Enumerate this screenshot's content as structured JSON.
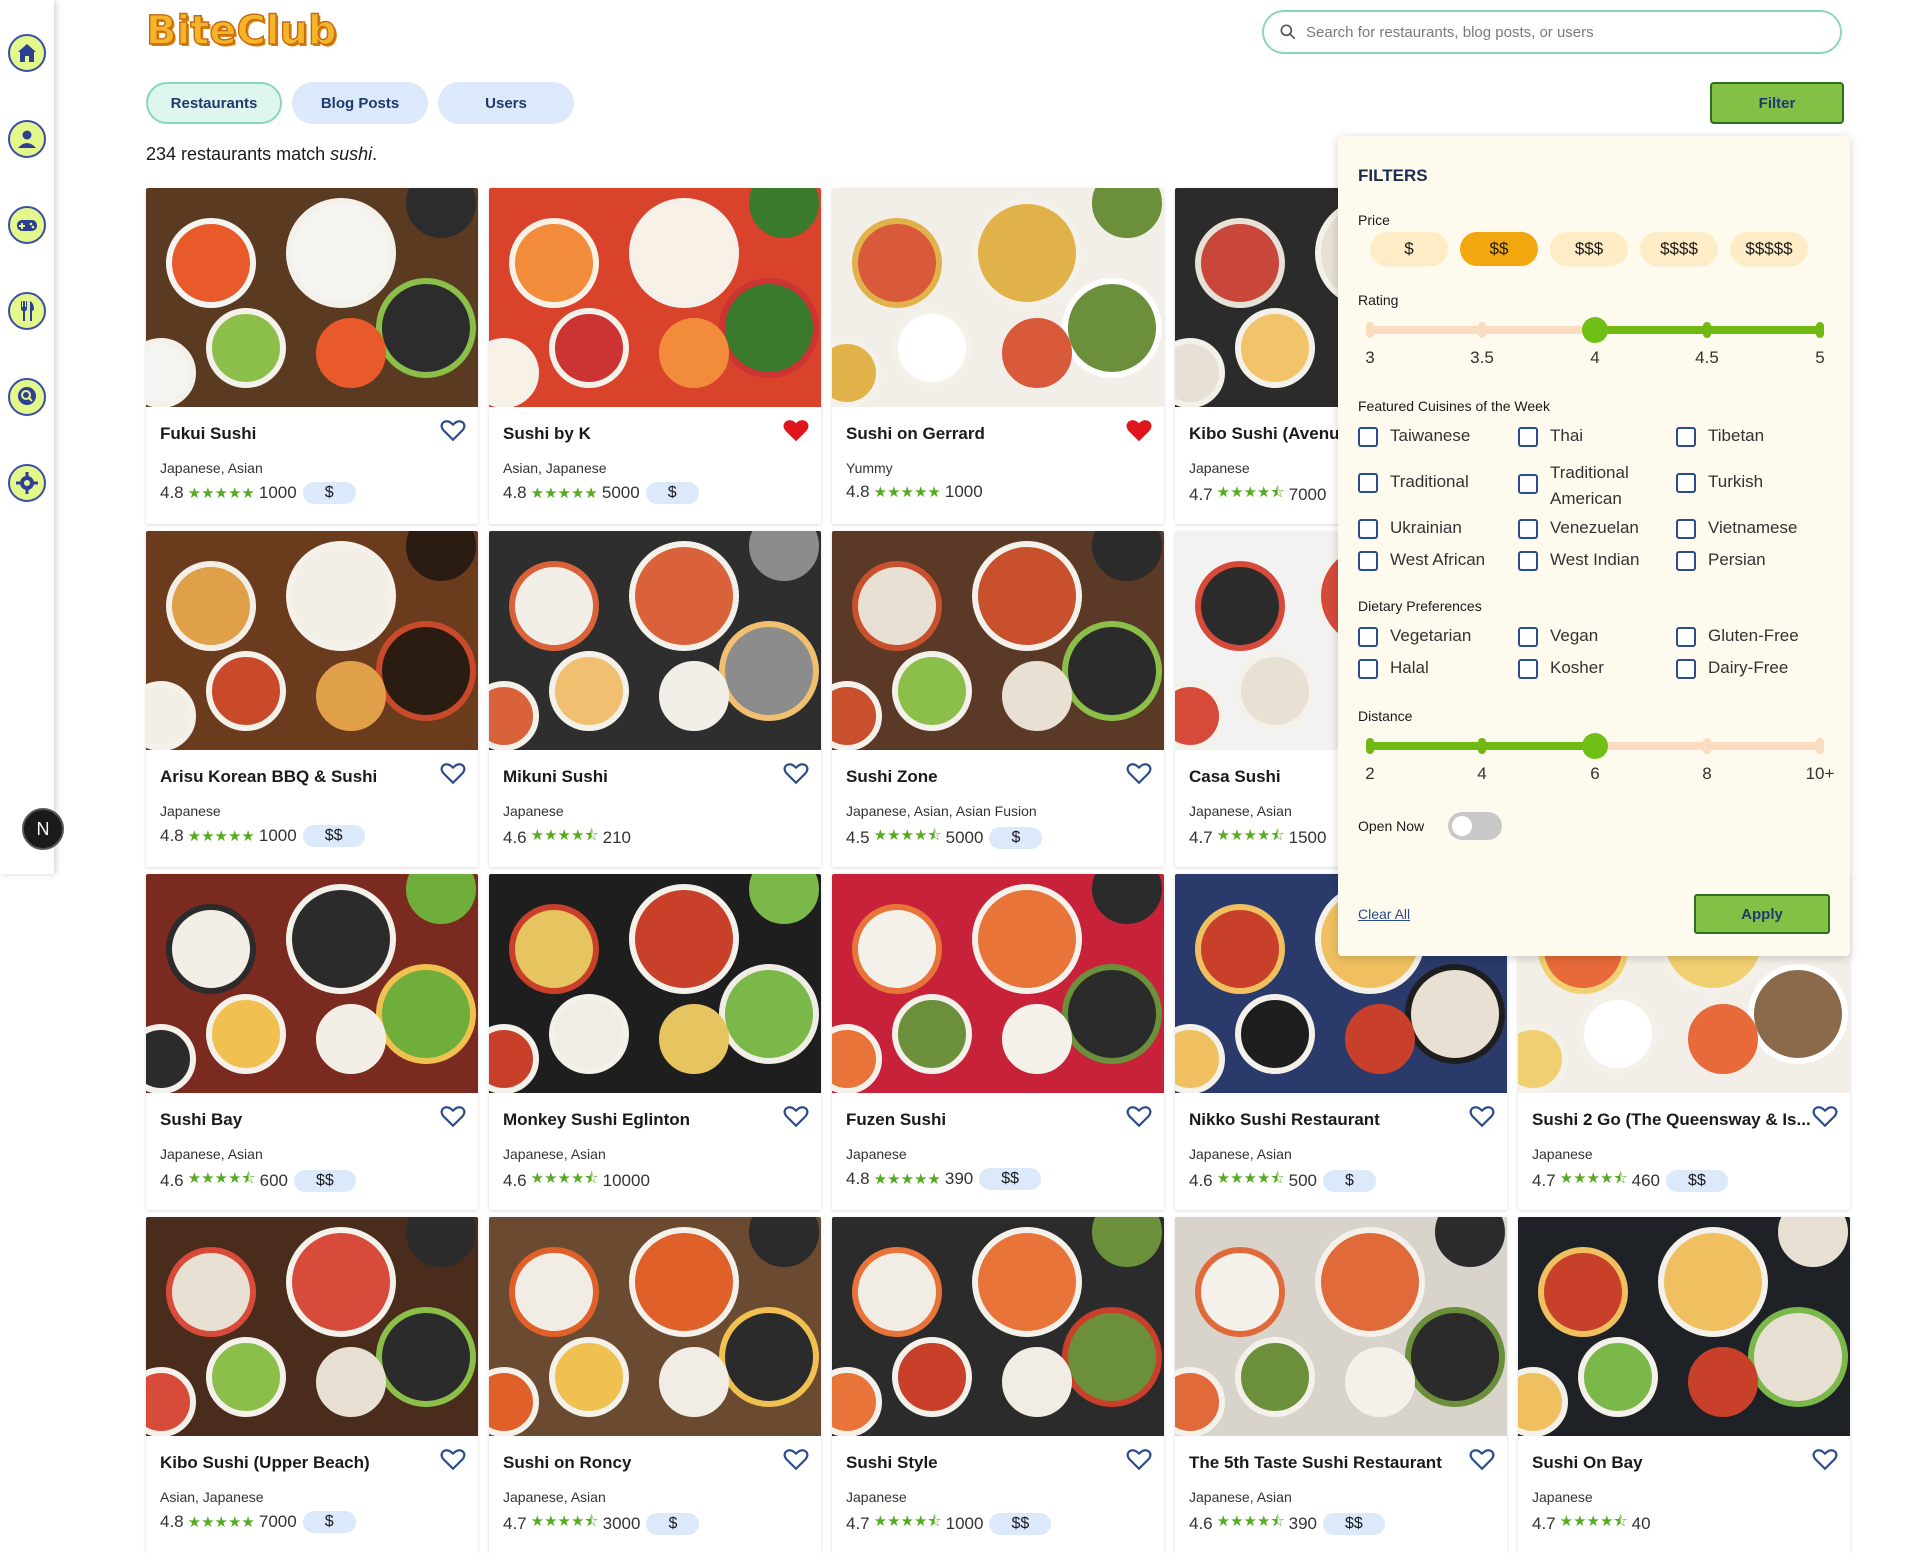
{
  "app": {
    "logo": "BiteClub"
  },
  "search": {
    "placeholder": "Search for restaurants, blog posts, or users"
  },
  "tabs": [
    {
      "label": "Restaurants",
      "active": true
    },
    {
      "label": "Blog Posts",
      "active": false
    },
    {
      "label": "Users",
      "active": false
    }
  ],
  "filter_button": "Filter",
  "results": {
    "count": "234",
    "text": " restaurants match ",
    "query": "sushi",
    "period": "."
  },
  "sidebar": {
    "icons": [
      "home-icon",
      "user-icon",
      "gamepad-icon",
      "cutlery-icon",
      "search-chat-icon",
      "gear-icon"
    ],
    "avatar_letter": "N"
  },
  "restaurants": [
    {
      "name": "Fukui Sushi",
      "cuisine": "Japanese, Asian",
      "rating": "4.8",
      "stars": 5,
      "reviews": "1000",
      "price": "$",
      "favorited": false
    },
    {
      "name": "Sushi by K",
      "cuisine": "Asian, Japanese",
      "rating": "4.8",
      "stars": 5,
      "reviews": "5000",
      "price": "$",
      "favorited": true
    },
    {
      "name": "Sushi on Gerrard",
      "cuisine": "Yummy",
      "rating": "4.8",
      "stars": 5,
      "reviews": "1000",
      "price": "",
      "favorited": true
    },
    {
      "name": "Kibo Sushi (Avenue",
      "cuisine": "Japanese",
      "rating": "4.7",
      "stars": 4.5,
      "reviews": "7000",
      "price": "",
      "favorited": false
    },
    {
      "name": "Arisu Korean BBQ & Sushi",
      "cuisine": "Japanese",
      "rating": "4.8",
      "stars": 5,
      "reviews": "1000",
      "price": "$$",
      "favorited": false
    },
    {
      "name": "Mikuni Sushi",
      "cuisine": "Japanese",
      "rating": "4.6",
      "stars": 4.5,
      "reviews": "210",
      "price": "",
      "favorited": false
    },
    {
      "name": "Sushi Zone",
      "cuisine": "Japanese, Asian, Asian Fusion",
      "rating": "4.5",
      "stars": 4.5,
      "reviews": "5000",
      "price": "$",
      "favorited": false
    },
    {
      "name": "Casa Sushi",
      "cuisine": "Japanese, Asian",
      "rating": "4.7",
      "stars": 4.5,
      "reviews": "1500",
      "price": "",
      "favorited": false
    },
    {
      "name": "Sushi Bay",
      "cuisine": "Japanese, Asian",
      "rating": "4.6",
      "stars": 4.5,
      "reviews": "600",
      "price": "$$",
      "favorited": false
    },
    {
      "name": "Monkey Sushi Eglinton",
      "cuisine": "Japanese, Asian",
      "rating": "4.6",
      "stars": 4.5,
      "reviews": "10000",
      "price": "",
      "favorited": false
    },
    {
      "name": "Fuzen Sushi",
      "cuisine": "Japanese",
      "rating": "4.8",
      "stars": 5,
      "reviews": "390",
      "price": "$$",
      "favorited": false
    },
    {
      "name": "Nikko Sushi Restaurant",
      "cuisine": "Japanese, Asian",
      "rating": "4.6",
      "stars": 4.5,
      "reviews": "500",
      "price": "$",
      "favorited": false
    },
    {
      "name": "Sushi 2 Go (The Queensway & Is...",
      "cuisine": "Japanese",
      "rating": "4.7",
      "stars": 4.5,
      "reviews": "460",
      "price": "$$",
      "favorited": false
    },
    {
      "name": "Kibo Sushi (Upper Beach)",
      "cuisine": "Asian, Japanese",
      "rating": "4.8",
      "stars": 5,
      "reviews": "7000",
      "price": "$",
      "favorited": false
    },
    {
      "name": "Sushi on Roncy",
      "cuisine": "Japanese, Asian",
      "rating": "4.7",
      "stars": 4.5,
      "reviews": "3000",
      "price": "$",
      "favorited": false
    },
    {
      "name": "Sushi Style",
      "cuisine": "Japanese",
      "rating": "4.7",
      "stars": 4.5,
      "reviews": "1000",
      "price": "$$",
      "favorited": false
    },
    {
      "name": "The 5th Taste Sushi Restaurant",
      "cuisine": "Japanese, Asian",
      "rating": "4.6",
      "stars": 4.5,
      "reviews": "390",
      "price": "$$",
      "favorited": false
    },
    {
      "name": "Sushi On Bay",
      "cuisine": "Japanese",
      "rating": "4.7",
      "stars": 4.5,
      "reviews": "40",
      "price": "",
      "favorited": false
    }
  ],
  "filters": {
    "title": "FILTERS",
    "price_label": "Price",
    "price_options": [
      "$",
      "$$",
      "$$$",
      "$$$$",
      "$$$$$"
    ],
    "price_selected": "$$",
    "rating_label": "Rating",
    "rating_ticks": [
      "3",
      "3.5",
      "4",
      "4.5",
      "5"
    ],
    "rating_value": "4",
    "cuisines_label": "Featured Cuisines of the Week",
    "cuisines": [
      "Taiwanese",
      "Thai",
      "Tibetan",
      "Traditional",
      "Traditional American",
      "Turkish",
      "Ukrainian",
      "Venezuelan",
      "Vietnamese",
      "West African",
      "West Indian",
      "Persian"
    ],
    "dietary_label": "Dietary Preferences",
    "dietary": [
      "Vegetarian",
      "Vegan",
      "Gluten-Free",
      "Halal",
      "Kosher",
      "Dairy-Free"
    ],
    "distance_label": "Distance",
    "distance_ticks": [
      "2",
      "4",
      "6",
      "8",
      "10+"
    ],
    "distance_value": "6",
    "open_now_label": "Open Now",
    "open_now": false,
    "clear_all": "Clear All",
    "apply": "Apply"
  },
  "colors": {
    "accent_green": "#82c145",
    "price_selected": "#f3a70f",
    "star": "#57ab23",
    "heart_fav": "#e0161f",
    "tab_bg": "#dbe9fb"
  }
}
